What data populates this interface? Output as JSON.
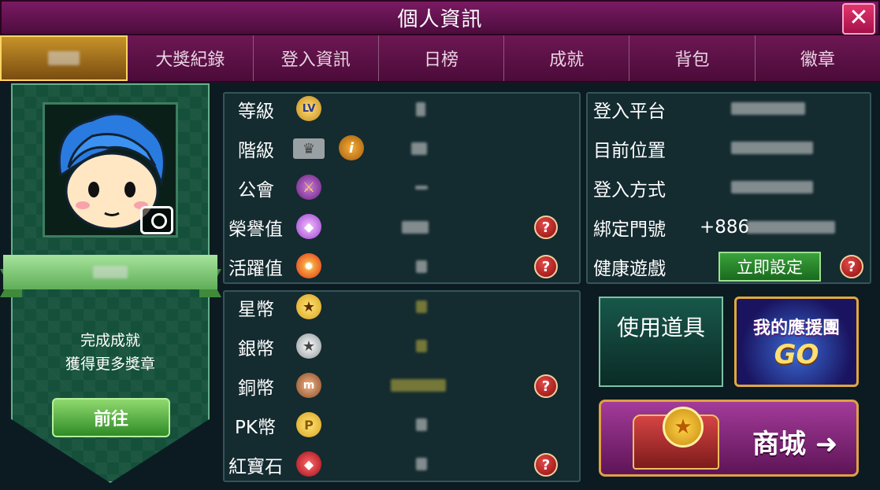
{
  "window": {
    "title": "個人資訊",
    "close_label": "✕"
  },
  "tabs": [
    {
      "label": "",
      "active": true
    },
    {
      "label": "大獎紀錄"
    },
    {
      "label": "登入資訊"
    },
    {
      "label": "日榜"
    },
    {
      "label": "成就"
    },
    {
      "label": "背包"
    },
    {
      "label": "徽章"
    }
  ],
  "profile": {
    "promo_line1": "完成成就",
    "promo_line2": "獲得更多獎章",
    "go_label": "前往"
  },
  "stats": [
    {
      "label": "等級",
      "icon": "level-icon"
    },
    {
      "label": "階級",
      "icon": "crown-icon",
      "info": "i"
    },
    {
      "label": "公會",
      "icon": "guild-icon"
    },
    {
      "label": "榮譽值",
      "icon": "honor-gem-icon",
      "help": "?"
    },
    {
      "label": "活躍值",
      "icon": "fire-icon",
      "help": "?"
    }
  ],
  "currencies": [
    {
      "label": "星幣",
      "icon": "star-coin-icon"
    },
    {
      "label": "銀幣",
      "icon": "silver-coin-icon"
    },
    {
      "label": "銅幣",
      "icon": "copper-coin-icon",
      "help": "?"
    },
    {
      "label": "PK幣",
      "icon": "pk-coin-icon"
    },
    {
      "label": "紅寶石",
      "icon": "ruby-icon",
      "help": "?"
    }
  ],
  "login": {
    "platform_label": "登入平台",
    "location_label": "目前位置",
    "method_label": "登入方式",
    "phone_label": "綁定門號",
    "phone_prefix": "+886",
    "health_label": "健康遊戲",
    "setup_label": "立即設定",
    "help": "?"
  },
  "actions": {
    "use_item": "使用道具",
    "support_line1": "我的應援團",
    "support_line2": "GO",
    "shop": "商城 ➜"
  },
  "colors": {
    "title_bar": "#6b1554",
    "active_tab": "#c7922a",
    "panel_bg": "#142b30"
  }
}
